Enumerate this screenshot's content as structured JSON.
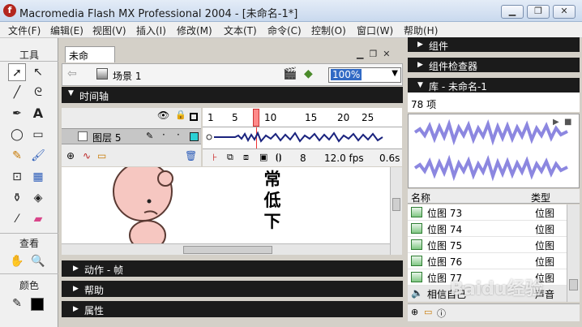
{
  "window": {
    "title": "Macromedia Flash MX Professional 2004 - [未命名-1*]",
    "min_label": "▁",
    "restore_label": "❐",
    "close_label": "✕"
  },
  "menu": [
    "文件(F)",
    "编辑(E)",
    "视图(V)",
    "插入(I)",
    "修改(M)",
    "文本(T)",
    "命令(C)",
    "控制(O)",
    "窗口(W)",
    "帮助(H)"
  ],
  "tools": {
    "title": "工具",
    "view_title": "查看",
    "color_title": "颜色"
  },
  "document": {
    "tab": "未命名-1*",
    "scene": "场景 1",
    "zoom": "100%",
    "timeline_title": "时间轴",
    "layer_name": "图层 5",
    "frame_numbers": [
      "1",
      "5",
      "10",
      "15",
      "20",
      "25"
    ],
    "current_frame": "8",
    "fps": "12.0 fps",
    "elapsed": "0.6s",
    "stage_text": [
      "常",
      "低",
      "下"
    ]
  },
  "panels": {
    "actions": "动作 - 帧",
    "help": "帮助",
    "properties": "属性"
  },
  "right": {
    "components": "组件",
    "inspector": "组件检查器",
    "library": "库 - 未命名-1",
    "item_count": "78 项",
    "col_name": "名称",
    "col_type": "类型",
    "items": [
      {
        "name": "位图 73",
        "type": "位图"
      },
      {
        "name": "位图 74",
        "type": "位图"
      },
      {
        "name": "位图 75",
        "type": "位图"
      },
      {
        "name": "位图 76",
        "type": "位图"
      },
      {
        "name": "位图 77",
        "type": "位图"
      },
      {
        "name": "相信自己",
        "type": "声音"
      }
    ]
  },
  "watermark": "Baidu经验"
}
